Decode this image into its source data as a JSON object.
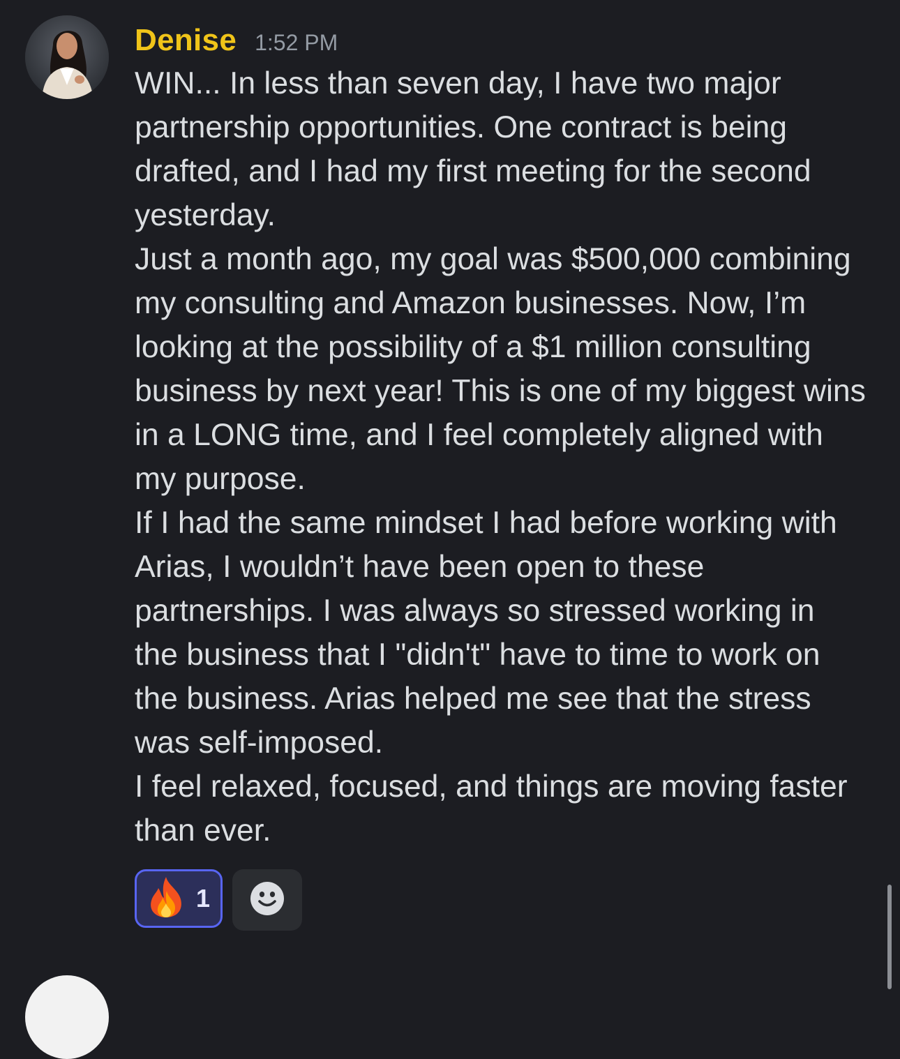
{
  "message": {
    "author": "Denise",
    "timestamp": "1:52 PM",
    "lines": [
      "WIN... In less than seven day, I have two major",
      "partnership opportunities. One contract is being",
      "drafted, and I had my first meeting for the second",
      "yesterday.",
      "Just a month ago, my goal was $500,000 combining",
      "my consulting and Amazon businesses. Now, I’m",
      "looking at the possibility of a $1 million consulting",
      "business by next year! This is one of my biggest wins",
      "in a LONG time, and I feel completely aligned with",
      "my purpose.",
      "If I had the same mindset I had before working with",
      "Arias, I wouldn’t have been open to these",
      "partnerships. I was always so stressed working in",
      "the business that I \"didn't\" have to time to work on",
      "the business. Arias helped me see that the stress",
      "was self-imposed.",
      "I feel relaxed, focused, and things are moving faster",
      "than ever."
    ],
    "reactions": [
      {
        "emoji_icon": "fire-icon",
        "count": "1",
        "selected": true
      }
    ],
    "add_reaction_icon": "smiley-face-icon"
  },
  "colors": {
    "background": "#1c1d22",
    "username": "#f0c419",
    "timestamp": "#949ba4",
    "text": "#dbdee1",
    "reaction_border": "#5865f2",
    "reaction_bg": "#2c2f5a"
  }
}
